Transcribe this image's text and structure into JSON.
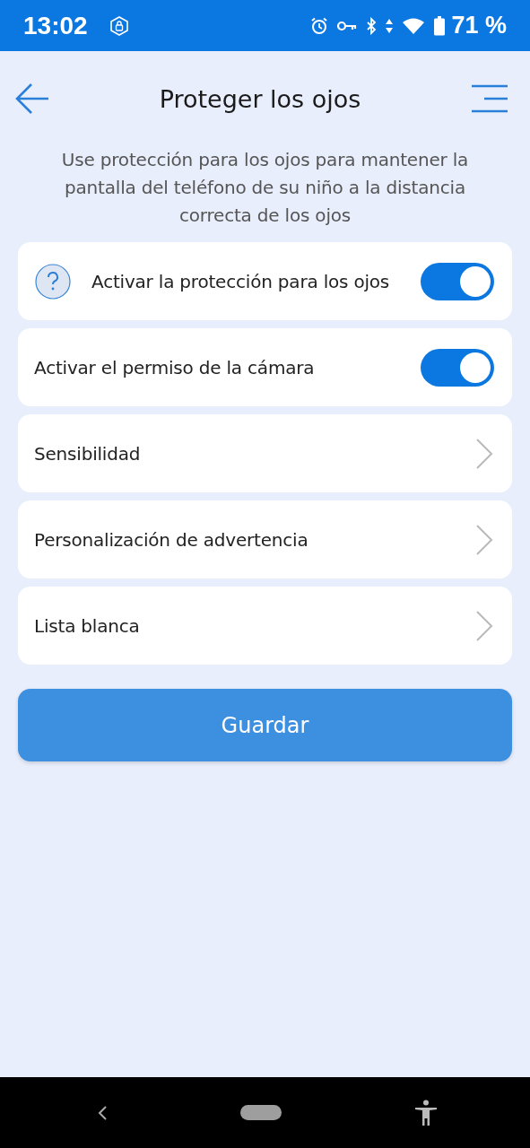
{
  "status_bar": {
    "time": "13:02",
    "battery": "71 %"
  },
  "header": {
    "title": "Proteger los ojos"
  },
  "description": "Use protección para los ojos para mantener la pantalla del teléfono de su niño a la distancia correcta de los ojos",
  "items": [
    {
      "kind": "toggle",
      "label": "Activar la protección para los ojos",
      "help": true,
      "on": true
    },
    {
      "kind": "toggle",
      "label": "Activar el permiso de la cámara",
      "help": false,
      "on": true
    },
    {
      "kind": "link",
      "label": "Sensibilidad"
    },
    {
      "kind": "link",
      "label": "Personalización de advertencia"
    },
    {
      "kind": "link",
      "label": "Lista blanca"
    }
  ],
  "save_button": "Guardar"
}
